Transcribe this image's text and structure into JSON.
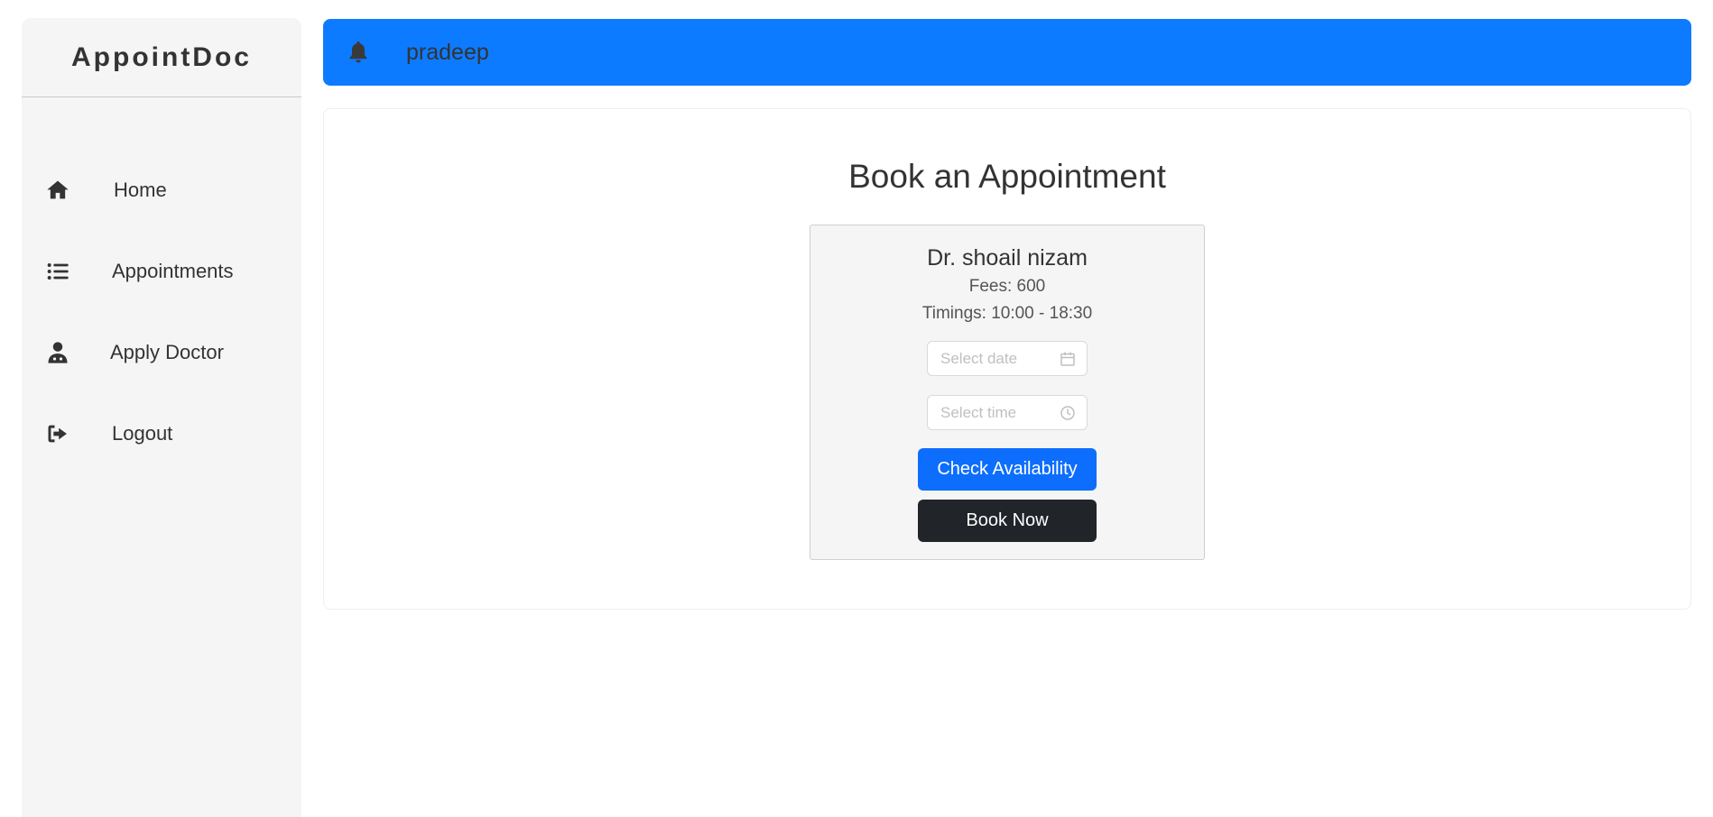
{
  "app": {
    "brand": "AppointDoc"
  },
  "sidebar": {
    "items": [
      {
        "label": "Home",
        "icon": "home-icon"
      },
      {
        "label": "Appointments",
        "icon": "list-icon"
      },
      {
        "label": "Apply Doctor",
        "icon": "doctor-icon"
      },
      {
        "label": "Logout",
        "icon": "logout-icon"
      }
    ]
  },
  "header": {
    "username": "pradeep",
    "icon": "bell-icon",
    "accent": "#0d7bff"
  },
  "main": {
    "title": "Book an Appointment",
    "doctor": {
      "name": "Dr. shoail nizam",
      "fees": "Fees: 600",
      "timings": "Timings: 10:00 - 18:30"
    },
    "date_placeholder": "Select date",
    "time_placeholder": "Select time",
    "check_label": "Check Availability",
    "book_label": "Book Now"
  },
  "colors": {
    "primary": "#0d6efd",
    "dark": "#212529",
    "sidebar_bg": "#f5f5f5"
  }
}
